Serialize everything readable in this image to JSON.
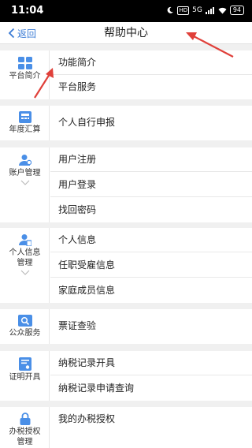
{
  "status_bar": {
    "time": "11:04",
    "network": "5G",
    "battery": "94"
  },
  "nav": {
    "back_label": "返回",
    "title": "帮助中心"
  },
  "colors": {
    "accent": "#3a7bd5",
    "annotation": "#e0403a"
  },
  "sections": [
    {
      "label": "平台简介",
      "icon": "grid-apps-icon",
      "items": [
        "功能简介",
        "平台服务"
      ]
    },
    {
      "label": "年度汇算",
      "icon": "calculator-icon",
      "items": [
        "个人自行申报"
      ]
    },
    {
      "label": "账户管理",
      "icon": "user-settings-icon",
      "items": [
        "用户注册",
        "用户登录",
        "找回密码"
      ]
    },
    {
      "label_line1": "个人信息",
      "label_line2": "管理",
      "icon": "user-info-icon",
      "items": [
        "个人信息",
        "任职受雇信息",
        "家庭成员信息"
      ]
    },
    {
      "label": "公众服务",
      "icon": "search-doc-icon",
      "items": [
        "票证查验"
      ]
    },
    {
      "label": "证明开具",
      "icon": "certificate-icon",
      "items": [
        "纳税记录开具",
        "纳税记录申请查询"
      ]
    },
    {
      "label_line1": "办税授权",
      "label_line2": "管理",
      "icon": "lock-icon",
      "items": [
        "我的办税授权"
      ]
    }
  ]
}
